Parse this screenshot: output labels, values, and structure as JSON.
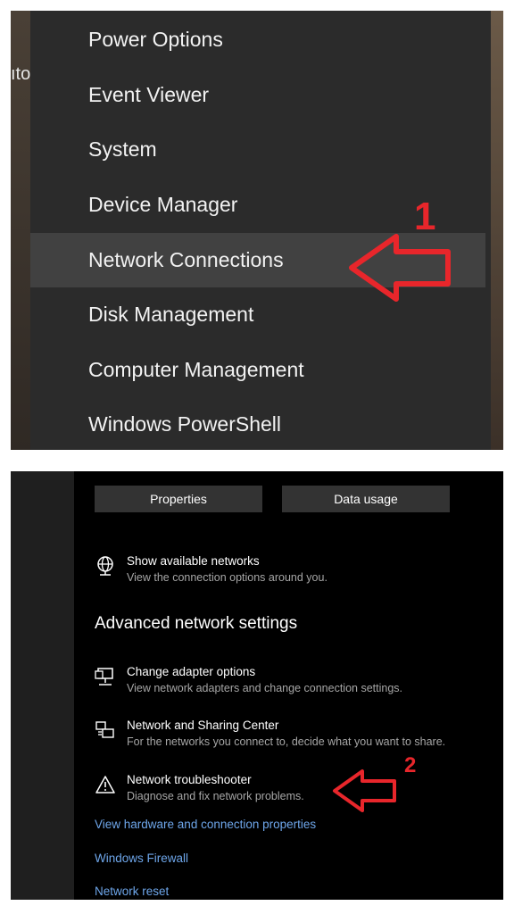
{
  "menu": {
    "side_text": "ıto",
    "items": [
      "Power Options",
      "Event Viewer",
      "System",
      "Device Manager",
      "Network Connections",
      "Disk Management",
      "Computer Management",
      "Windows PowerShell"
    ],
    "annotation_number": "1"
  },
  "network": {
    "buttons": {
      "properties": "Properties",
      "data_usage": "Data usage"
    },
    "show_networks": {
      "title": "Show available networks",
      "desc": "View the connection options around you."
    },
    "section_title": "Advanced network settings",
    "options": [
      {
        "title": "Change adapter options",
        "desc": "View network adapters and change connection settings."
      },
      {
        "title": "Network and Sharing Center",
        "desc": "For the networks you connect to, decide what you want to share."
      },
      {
        "title": "Network troubleshooter",
        "desc": "Diagnose and fix network problems."
      }
    ],
    "links": [
      "View hardware and connection properties",
      "Windows Firewall",
      "Network reset"
    ],
    "annotation_number": "2"
  },
  "colors": {
    "annotation_red": "#e8262b",
    "link_blue": "#6ea6ea"
  }
}
